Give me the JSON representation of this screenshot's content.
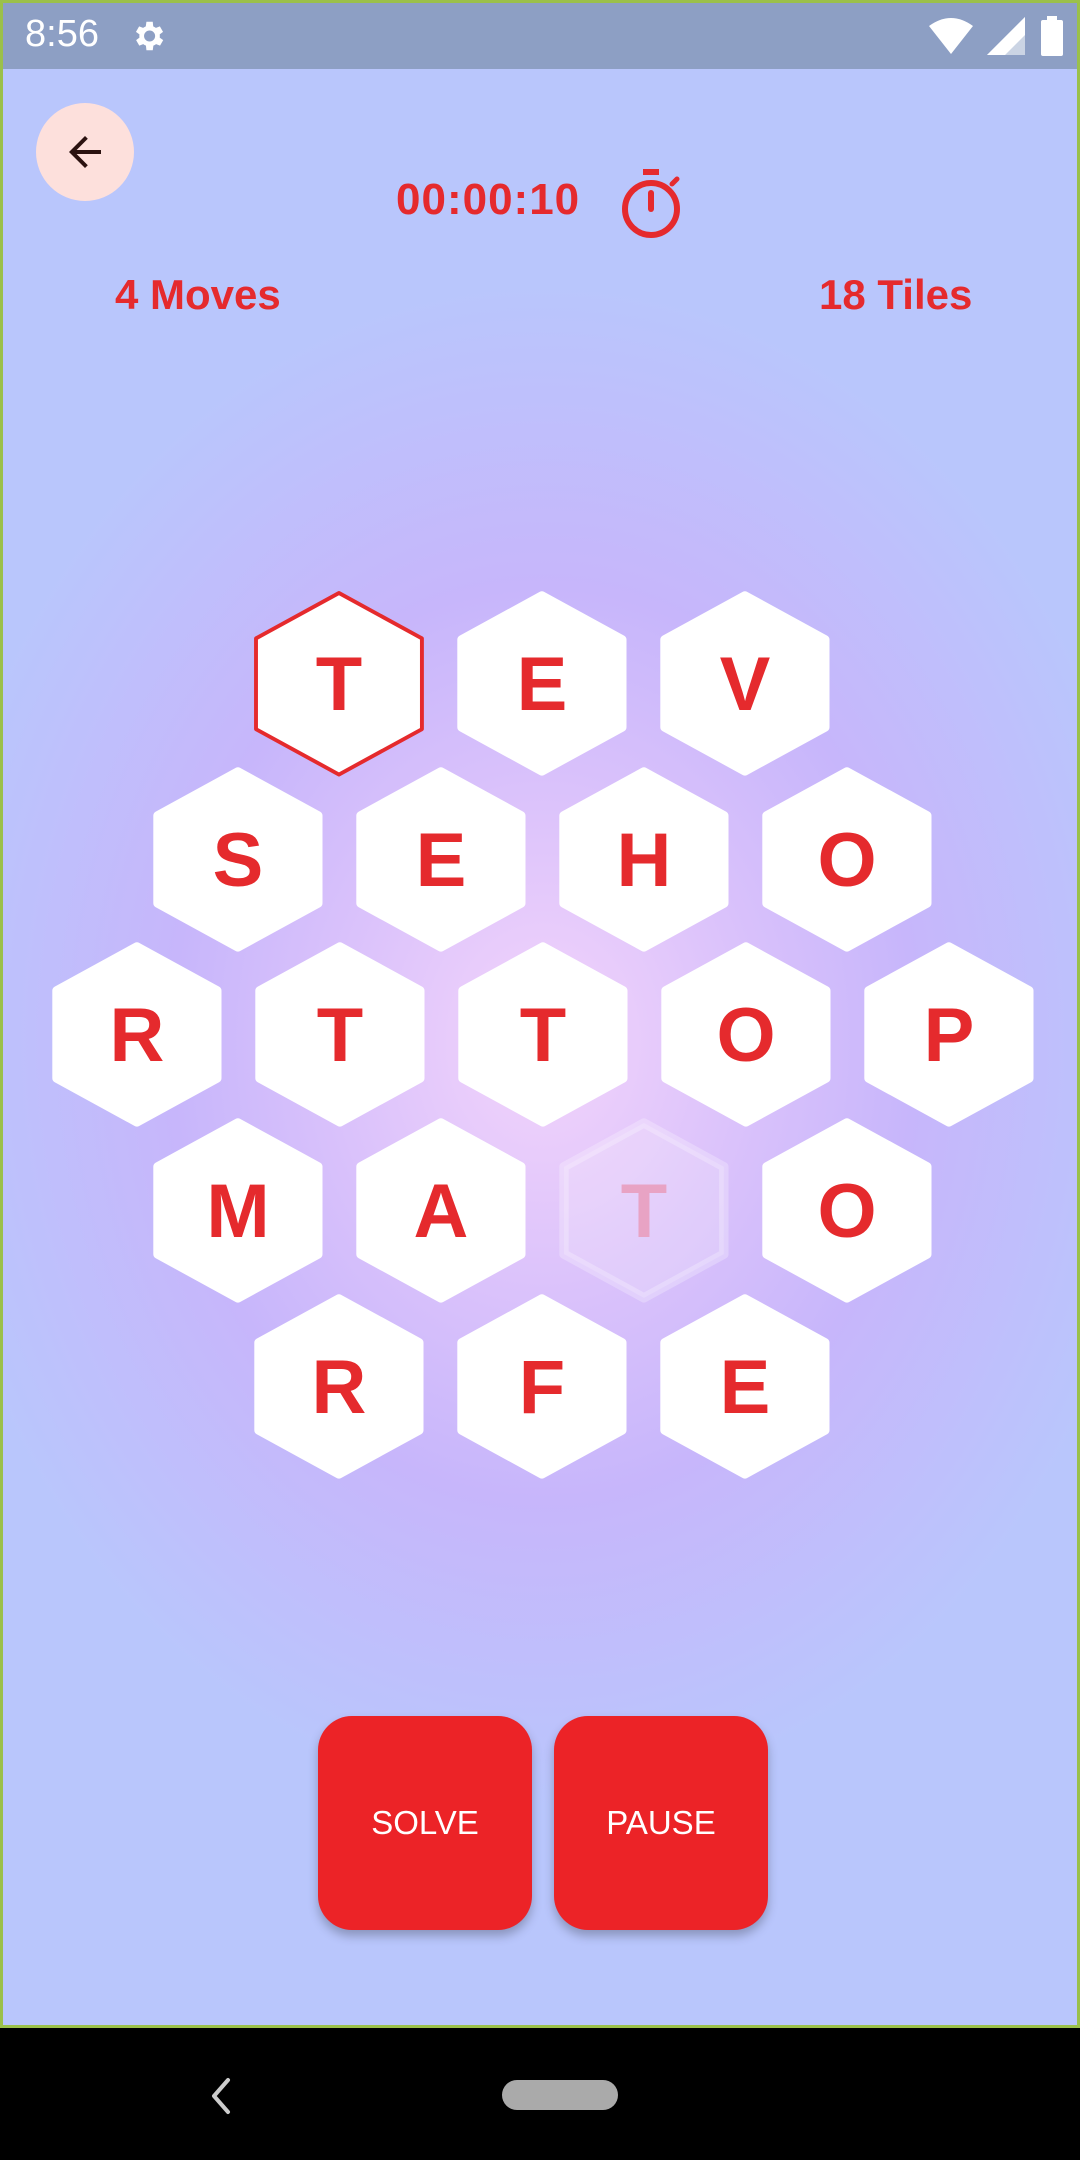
{
  "status_bar": {
    "time": "8:56"
  },
  "header": {
    "timer": "00:00:10",
    "moves": "4 Moves",
    "tiles": "18 Tiles"
  },
  "board": {
    "rows": [
      [
        "T",
        "E",
        "V"
      ],
      [
        "S",
        "E",
        "H",
        "O"
      ],
      [
        "R",
        "T",
        "T",
        "O",
        "P"
      ],
      [
        "M",
        "A",
        "T",
        "O"
      ],
      [
        "R",
        "F",
        "E"
      ]
    ],
    "selected_tile": "T (row 1, first)",
    "faded_tile": "T (row 4, third)"
  },
  "buttons": {
    "solve": "SOLVE",
    "pause": "PAUSE"
  },
  "colors": {
    "accent": "#E52A2D",
    "button": "#EC2327",
    "tile": "#FFFFFF"
  }
}
